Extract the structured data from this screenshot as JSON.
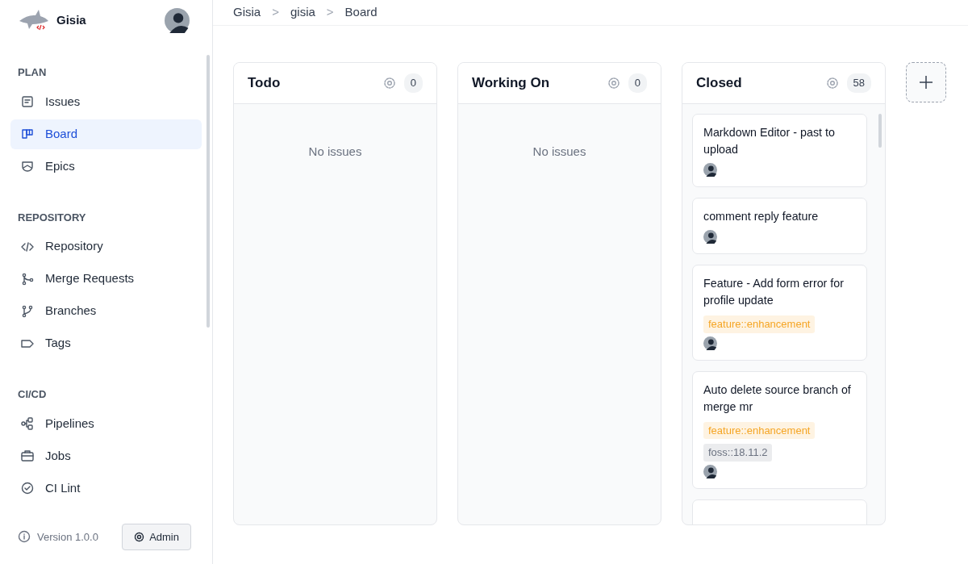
{
  "app": {
    "name": "Gisia"
  },
  "sidebar": {
    "sections": [
      {
        "title": "PLAN",
        "items": [
          {
            "label": "Issues",
            "selected": false
          },
          {
            "label": "Board",
            "selected": true
          },
          {
            "label": "Epics",
            "selected": false
          }
        ]
      },
      {
        "title": "REPOSITORY",
        "items": [
          {
            "label": "Repository",
            "selected": false
          },
          {
            "label": "Merge Requests",
            "selected": false
          },
          {
            "label": "Branches",
            "selected": false
          },
          {
            "label": "Tags",
            "selected": false
          }
        ]
      },
      {
        "title": "CI/CD",
        "items": [
          {
            "label": "Pipelines",
            "selected": false
          },
          {
            "label": "Jobs",
            "selected": false
          },
          {
            "label": "CI Lint",
            "selected": false
          }
        ]
      }
    ],
    "version": "Version 1.0.0",
    "admin_button": "Admin"
  },
  "breadcrumb": [
    "Gisia",
    "gisia",
    "Board"
  ],
  "breadcrumb_separator": ">",
  "columns": [
    {
      "title": "Todo",
      "count": "0",
      "empty_text": "No issues"
    },
    {
      "title": "Working On",
      "count": "0",
      "empty_text": "No issues"
    },
    {
      "title": "Closed",
      "count": "58",
      "cards": [
        {
          "kind": "issue",
          "title": "Markdown Editor - past to upload"
        },
        {
          "kind": "issue",
          "title": "comment reply feature"
        },
        {
          "kind": "issue",
          "title": "Feature - Add form error for profile update",
          "labels": [
            {
              "text": "feature::enhancement",
              "color": "#f5a524"
            }
          ]
        },
        {
          "kind": "issue",
          "title": "Auto delete source branch of merge mr",
          "labels": [
            {
              "text": "feature::enhancement",
              "color": "#f5a524"
            },
            {
              "text": "foss::18.11.2",
              "color": "#6b7280"
            }
          ]
        },
        {
          "kind": "cut_off"
        }
      ]
    }
  ]
}
